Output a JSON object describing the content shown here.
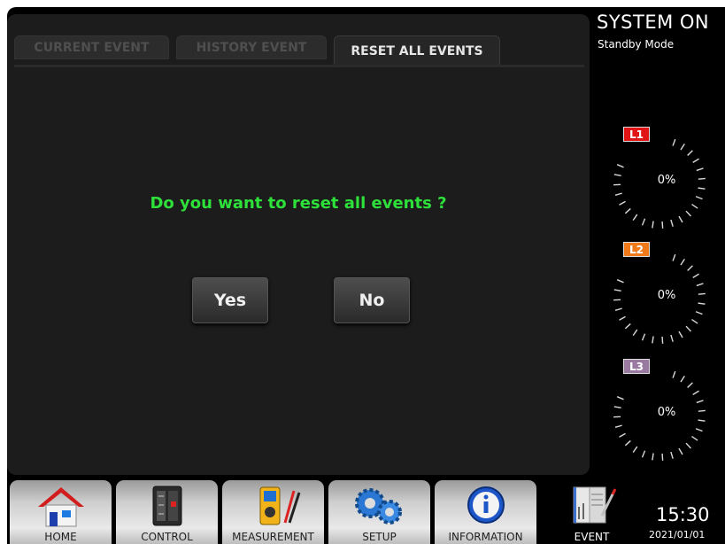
{
  "tabs": [
    {
      "label": "CURRENT EVENT",
      "active": false
    },
    {
      "label": "HISTORY EVENT",
      "active": false
    },
    {
      "label": "RESET ALL EVENTS",
      "active": true
    }
  ],
  "dialog": {
    "question": "Do you want to reset all events ?",
    "yes_label": "Yes",
    "no_label": "No"
  },
  "status": {
    "title": "SYSTEM ON",
    "mode": "Standby Mode"
  },
  "phases": [
    {
      "label": "L1",
      "value": "0%",
      "color": "#e01414"
    },
    {
      "label": "L2",
      "value": "0%",
      "color": "#f07a1a"
    },
    {
      "label": "L3",
      "value": "0%",
      "color": "#9a7aa0"
    }
  ],
  "nav": [
    {
      "label": "HOME",
      "icon": "home-icon"
    },
    {
      "label": "CONTROL",
      "icon": "control-panel-icon"
    },
    {
      "label": "MEASUREMENT",
      "icon": "multimeter-icon"
    },
    {
      "label": "SETUP",
      "icon": "gears-icon"
    },
    {
      "label": "INFORMATION",
      "icon": "info-icon"
    },
    {
      "label": "EVENT",
      "icon": "event-log-icon",
      "active": true
    }
  ],
  "clock": {
    "time": "15:30",
    "date": "2021/01/01"
  },
  "colors": {
    "question_text": "#2ee03a",
    "background": "#000000"
  }
}
